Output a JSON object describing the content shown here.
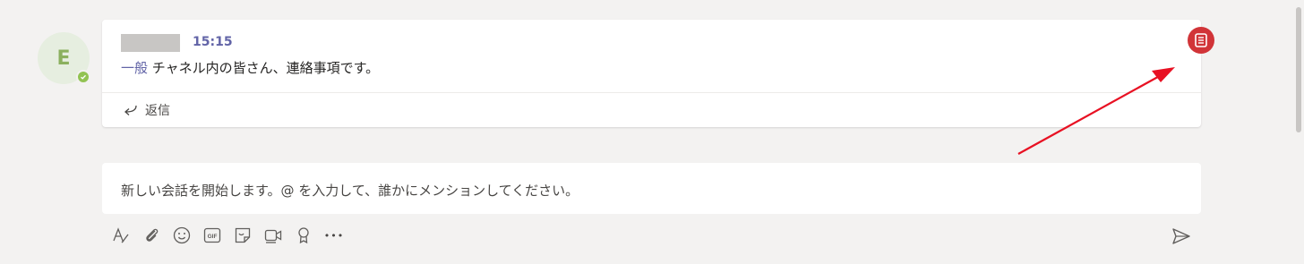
{
  "post": {
    "avatar_initial": "E",
    "time": "15:15",
    "channel_link": "一般",
    "message_text": " チャネル内の皆さん、連絡事項です。",
    "reply_label": "返信"
  },
  "compose": {
    "placeholder": "新しい会話を開始します。@ を入力して、誰かにメンションしてください。"
  },
  "toolbar": {
    "icons": [
      "format-icon",
      "attach-icon",
      "emoji-icon",
      "gif-icon",
      "sticker-icon",
      "meet-now-icon",
      "praise-icon",
      "more-options-icon",
      "send-icon"
    ],
    "gif_label": "GIF",
    "more_label": "•••"
  },
  "colors": {
    "accent": "#6264a7",
    "announcement": "#d13438",
    "presence": "#92c353",
    "annotation_arrow": "#e81123"
  }
}
